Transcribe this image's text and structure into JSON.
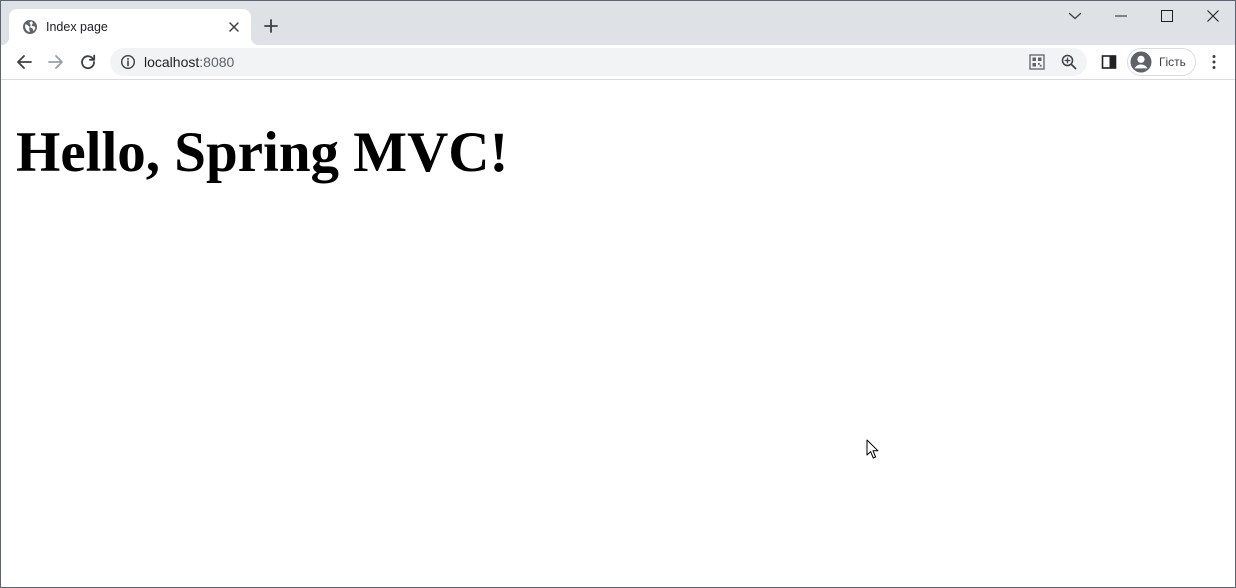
{
  "browser": {
    "tab": {
      "title": "Index page",
      "favicon": "globe-icon"
    },
    "new_tab_icon": "plus-icon",
    "window_controls": [
      "tab-search-icon",
      "minimize-icon",
      "maximize-icon",
      "close-icon"
    ],
    "toolbar": {
      "back_icon": "arrow-left-icon",
      "forward_icon": "arrow-right-icon",
      "reload_icon": "reload-icon",
      "site_info_icon": "info-icon",
      "url_host": "localhost",
      "url_port": ":8080",
      "omnibox_actions": [
        "qr-code-icon",
        "zoom-icon"
      ],
      "side_panel_icon": "side-panel-icon",
      "profile_label": "Гість",
      "menu_icon": "kebab-menu-icon"
    }
  },
  "page": {
    "heading": "Hello, Spring MVC!"
  },
  "colors": {
    "tabstrip_bg": "#dee1e6",
    "omnibox_bg": "#f1f3f4",
    "icon_gray": "#5f6368",
    "text_dark": "#202124"
  }
}
